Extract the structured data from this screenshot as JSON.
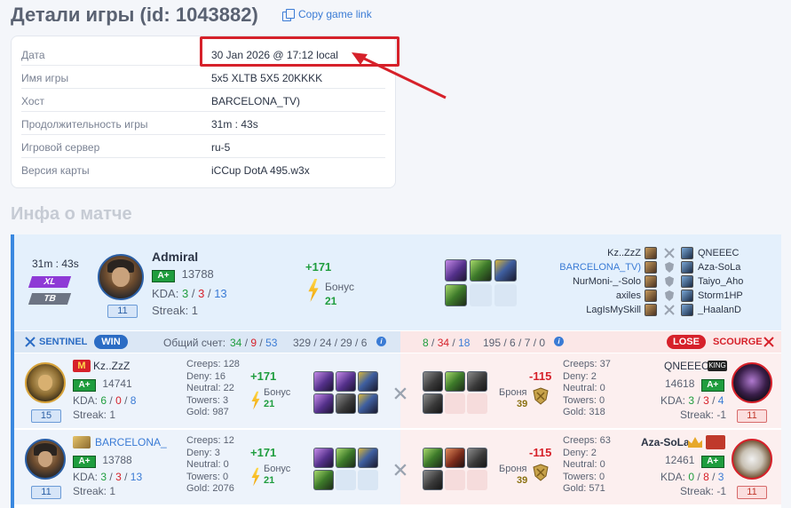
{
  "page": {
    "title": "Детали игры (id: 1043882)",
    "copy_link": "Copy game link"
  },
  "details": [
    {
      "key": "Дата",
      "value": "30 Jan 2026 @ 17:12 local"
    },
    {
      "key": "Имя игры",
      "value": "5x5 XLTB 5X5 20KKKK"
    },
    {
      "key": "Хост",
      "value": "BARCELONA_TV)"
    },
    {
      "key": "Продолжительность игры",
      "value": "31m : 43s"
    },
    {
      "key": "Игровой сервер",
      "value": "ru-5"
    },
    {
      "key": "Версия карты",
      "value": "iCCup DotA 495.w3x"
    }
  ],
  "section_title": "Инфа о матче",
  "summary": {
    "duration": "31m : 43s",
    "mode1": "XL",
    "mode2": "TB",
    "player": "Admiral",
    "rank": "A+",
    "rating": "13788",
    "kda_label": "KDA:",
    "kda": [
      "3",
      "3",
      "13"
    ],
    "streak": "Streak: 1",
    "level": "11",
    "gain": "+171",
    "bonus_label": "Бонус",
    "bonus": "21",
    "sep": "/",
    "matchups": [
      {
        "left": "Kz..ZzZ",
        "right": "QNEEEC"
      },
      {
        "left": "BARCELONA_TV)",
        "right": "Aza-SoLa"
      },
      {
        "left": "NurMoni-_-Solo",
        "right": "Taiyo_Aho"
      },
      {
        "left": "axiles",
        "right": "Storm1HP"
      },
      {
        "left": "LagIsMySkill",
        "right": "_HaalanD"
      }
    ]
  },
  "team_bar": {
    "sentinel": "SENTINEL",
    "win": "WIN",
    "score_label": "Общий счет:",
    "s_kills": "34",
    "s_deaths": "9",
    "s_assists": "53",
    "s_cs": "329 / 24 / 29 / 6",
    "c_kills": "8",
    "c_deaths": "34",
    "c_assists": "18",
    "c_cs": "195 / 6 / 7 / 0",
    "lose": "LOSE",
    "scourge": "SCOURGE",
    "info": "i"
  },
  "rows": [
    {
      "l_name": "Kz..ZzZ",
      "l_rank": "A+",
      "l_rating": "14741",
      "l_kda": [
        "6",
        "0",
        "8"
      ],
      "l_streak": "Streak: 1",
      "l_level": "15",
      "l_creeps": "Creeps: 128",
      "l_deny": "Deny: 16",
      "l_neutral": "Neutral: 22",
      "l_towers": "Towers: 3",
      "l_gold": "Gold: 987",
      "l_gain": "+171",
      "l_bonus_label": "Бонус",
      "l_bonus": "21",
      "r_gain": "-115",
      "r_armor_label": "Броня",
      "r_armor": "39",
      "r_creeps": "Creeps: 37",
      "r_deny": "Deny: 2",
      "r_neutral": "Neutral: 0",
      "r_towers": "Towers: 0",
      "r_gold": "Gold: 318",
      "r_name": "QNEEEC",
      "r_tag": "KING",
      "r_rating": "14618",
      "r_rank": "A+",
      "r_kda": [
        "3",
        "3",
        "4"
      ],
      "r_streak": "Streak: -1",
      "r_level": "11"
    },
    {
      "l_name": "BARCELONA_",
      "l_rank": "A+",
      "l_rating": "13788",
      "l_kda": [
        "3",
        "3",
        "13"
      ],
      "l_streak": "Streak: 1",
      "l_level": "11",
      "l_creeps": "Creeps: 12",
      "l_deny": "Deny: 3",
      "l_neutral": "Neutral: 0",
      "l_towers": "Towers: 0",
      "l_gold": "Gold: 2076",
      "l_gain": "+171",
      "l_bonus_label": "Бонус",
      "l_bonus": "21",
      "r_gain": "-115",
      "r_armor_label": "Броня",
      "r_armor": "39",
      "r_creeps": "Creeps: 63",
      "r_deny": "Deny: 2",
      "r_neutral": "Neutral: 0",
      "r_towers": "Towers: 0",
      "r_gold": "Gold: 571",
      "r_name": "Aza-SoLa",
      "r_rating": "12461",
      "r_rank": "A+",
      "r_kda": [
        "0",
        "8",
        "3"
      ],
      "r_streak": "Streak: -1",
      "r_level": "11"
    }
  ],
  "colors": {
    "accent": "#3a7bd5",
    "win": "#2b6cc4",
    "lose": "#d6212a",
    "positive": "#1f9d3e",
    "highlight": "#d6212a"
  }
}
